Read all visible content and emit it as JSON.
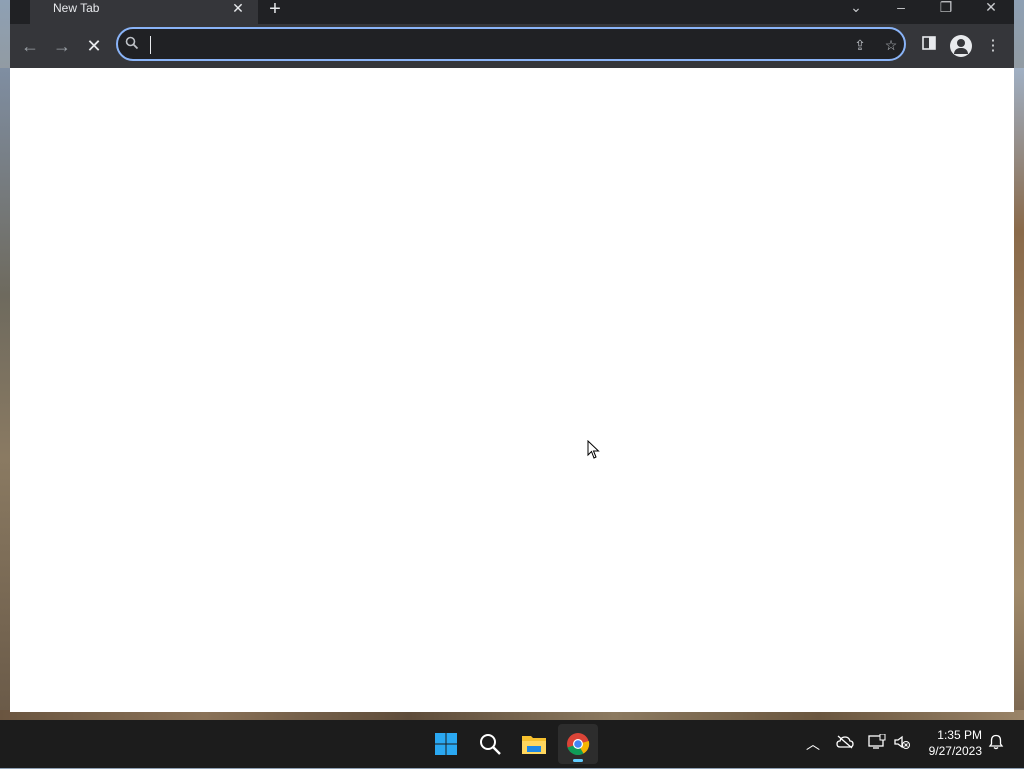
{
  "browser": {
    "tab": {
      "title": "New Tab",
      "close_icon": "close-icon"
    },
    "new_tab_icon": "plus-icon",
    "window_controls": [
      "tab-search-icon",
      "minimize-icon",
      "restore-icon",
      "close-icon"
    ],
    "nav": {
      "back_icon": "arrow-left-icon",
      "forward_icon": "arrow-right-icon",
      "stop_icon": "stop-icon"
    },
    "omnibox": {
      "value": "",
      "placeholder": "",
      "search_icon": "search-icon",
      "share_icon": "share-icon",
      "bookmark_icon": "star-icon"
    },
    "side_panel_icon": "side-panel-icon",
    "profile_icon": "profile-icon",
    "menu_icon": "more-vert-icon",
    "accent_color": "#8ab4f8"
  },
  "taskbar": {
    "apps": [
      "start-icon",
      "search-icon",
      "file-explorer-icon",
      "chrome-icon"
    ],
    "active_app": "chrome-icon",
    "tray_icons": [
      "chevron-up-icon",
      "onedrive-icon",
      "network-icon",
      "volume-muted-icon"
    ],
    "time": "1:35 PM",
    "date": "9/27/2023",
    "notification_icon": "bell-icon"
  }
}
